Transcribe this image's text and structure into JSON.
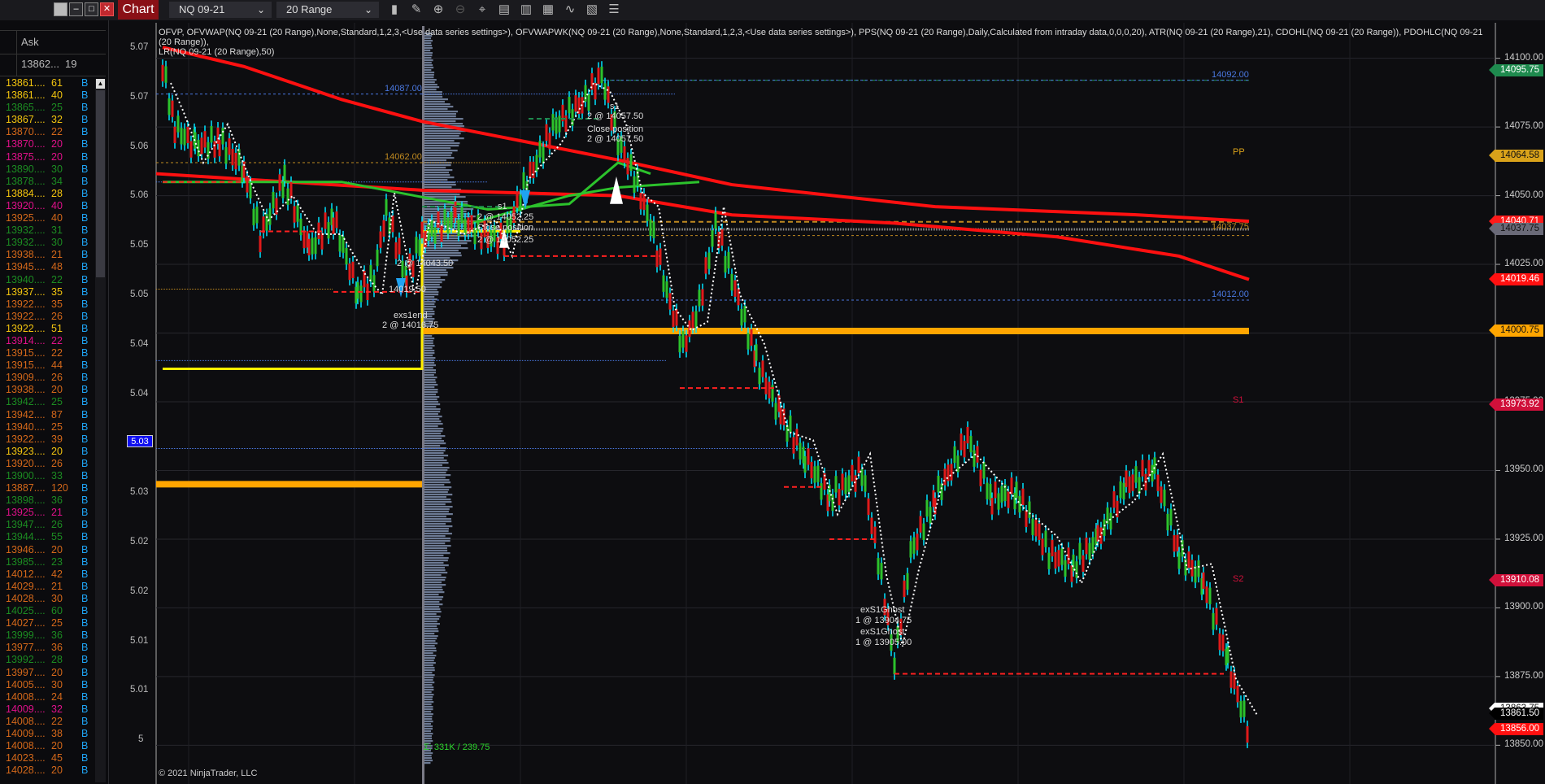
{
  "window": {
    "buttons": [
      "minimize-all",
      "minimize",
      "maximize",
      "close"
    ]
  },
  "toolbar": {
    "tab_label": "Chart",
    "instrument": "NQ 09-21",
    "bar_type": "20 Range",
    "icons": [
      "bar-style-icon",
      "drawing-tool-icon",
      "zoom-in-icon",
      "zoom-out-icon",
      "crosshair-icon",
      "data-box-icon",
      "chart-trader-icon",
      "strategies-icon",
      "indicators-icon",
      "properties-icon",
      "templates-icon"
    ]
  },
  "left_panel": {
    "header": "Ask",
    "ask_price": "13862...",
    "ask_size": "19",
    "rows": [
      {
        "p": "13861....",
        "q": "61",
        "c": "#f2c40f"
      },
      {
        "p": "13861....",
        "q": "40",
        "c": "#f2c40f"
      },
      {
        "p": "13865....",
        "q": "25",
        "c": "#1c8c22"
      },
      {
        "p": "13867....",
        "q": "32",
        "c": "#f2c40f"
      },
      {
        "p": "13870....",
        "q": "22",
        "c": "#d4681a"
      },
      {
        "p": "13870....",
        "q": "20",
        "c": "#e0108a"
      },
      {
        "p": "13875....",
        "q": "20",
        "c": "#e0108a"
      },
      {
        "p": "13890....",
        "q": "30",
        "c": "#1c8c22"
      },
      {
        "p": "13878....",
        "q": "34",
        "c": "#1c8c22"
      },
      {
        "p": "13884....",
        "q": "28",
        "c": "#f2c40f"
      },
      {
        "p": "13920....",
        "q": "40",
        "c": "#e0108a"
      },
      {
        "p": "13925....",
        "q": "40",
        "c": "#d4681a"
      },
      {
        "p": "13932....",
        "q": "31",
        "c": "#1c8c22"
      },
      {
        "p": "13932....",
        "q": "30",
        "c": "#1c8c22"
      },
      {
        "p": "13938....",
        "q": "21",
        "c": "#d4681a"
      },
      {
        "p": "13945....",
        "q": "48",
        "c": "#d4681a"
      },
      {
        "p": "13940....",
        "q": "22",
        "c": "#1c8c22"
      },
      {
        "p": "13937....",
        "q": "35",
        "c": "#f2c40f"
      },
      {
        "p": "13922....",
        "q": "35",
        "c": "#d4681a"
      },
      {
        "p": "13922....",
        "q": "26",
        "c": "#d4681a"
      },
      {
        "p": "13922....",
        "q": "51",
        "c": "#f2c40f"
      },
      {
        "p": "13914....",
        "q": "22",
        "c": "#e0108a"
      },
      {
        "p": "13915....",
        "q": "22",
        "c": "#d4681a"
      },
      {
        "p": "13915....",
        "q": "44",
        "c": "#d4681a"
      },
      {
        "p": "13909....",
        "q": "26",
        "c": "#d4681a"
      },
      {
        "p": "13938....",
        "q": "20",
        "c": "#d4681a"
      },
      {
        "p": "13942....",
        "q": "25",
        "c": "#1c8c22"
      },
      {
        "p": "13942....",
        "q": "87",
        "c": "#d4681a"
      },
      {
        "p": "13940....",
        "q": "25",
        "c": "#d4681a"
      },
      {
        "p": "13922....",
        "q": "39",
        "c": "#d4681a"
      },
      {
        "p": "13923....",
        "q": "20",
        "c": "#f2c40f"
      },
      {
        "p": "13920....",
        "q": "26",
        "c": "#d4681a"
      },
      {
        "p": "13900....",
        "q": "33",
        "c": "#1c8c22"
      },
      {
        "p": "13887....",
        "q": "120",
        "c": "#d4681a"
      },
      {
        "p": "13898....",
        "q": "36",
        "c": "#1c8c22"
      },
      {
        "p": "13925....",
        "q": "21",
        "c": "#e0108a"
      },
      {
        "p": "13947....",
        "q": "26",
        "c": "#1c8c22"
      },
      {
        "p": "13944....",
        "q": "55",
        "c": "#1c8c22"
      },
      {
        "p": "13946....",
        "q": "20",
        "c": "#d4681a"
      },
      {
        "p": "13985....",
        "q": "23",
        "c": "#1c8c22"
      },
      {
        "p": "14012....",
        "q": "42",
        "c": "#d4681a"
      },
      {
        "p": "14029....",
        "q": "21",
        "c": "#d4681a"
      },
      {
        "p": "14028....",
        "q": "30",
        "c": "#d4681a"
      },
      {
        "p": "14025....",
        "q": "60",
        "c": "#1c8c22"
      },
      {
        "p": "14027....",
        "q": "25",
        "c": "#d4681a"
      },
      {
        "p": "13999....",
        "q": "36",
        "c": "#1c8c22"
      },
      {
        "p": "13977....",
        "q": "36",
        "c": "#d4681a"
      },
      {
        "p": "13992....",
        "q": "28",
        "c": "#1c8c22"
      },
      {
        "p": "13997....",
        "q": "20",
        "c": "#d4681a"
      },
      {
        "p": "14005....",
        "q": "30",
        "c": "#d4681a"
      },
      {
        "p": "14008....",
        "q": "24",
        "c": "#d4681a"
      },
      {
        "p": "14009....",
        "q": "32",
        "c": "#e0108a"
      },
      {
        "p": "14008....",
        "q": "22",
        "c": "#d4681a"
      },
      {
        "p": "14009....",
        "q": "38",
        "c": "#d4681a"
      },
      {
        "p": "14008....",
        "q": "20",
        "c": "#d4681a"
      },
      {
        "p": "14023....",
        "q": "45",
        "c": "#d4681a"
      },
      {
        "p": "14028....",
        "q": "20",
        "c": "#d4681a"
      }
    ],
    "side_label": "B"
  },
  "chart": {
    "indicator_line1": "OFVP, OFVWAP(NQ 09-21 (20 Range),None,Standard,1,2,3,<Use data series settings>), OFVWAPWK(NQ 09-21 (20 Range),None,Standard,1,2,3,<Use data series settings>), PPS(NQ 09-21 (20 Range),Daily,Calculated from intraday data,0,0,0,20), ATR(NQ 09-21 (20 Range),21), CDOHL(NQ 09-21 (20 Range)), PDOHLC(NQ 09-21 (20 Range)),",
    "indicator_line2": "LR(NQ 09-21 (20 Range),50)",
    "left_axis_ticks": [
      "5.07",
      "5.07",
      "5.06",
      "5.06",
      "5.05",
      "5.05",
      "5.04",
      "5.04",
      "5.03",
      "5.03",
      "5.02",
      "5.02",
      "5.01",
      "5.01",
      "5"
    ],
    "left_axis_cursor": "5.03",
    "right_axis_ticks": [
      "14100.00",
      "14075.00",
      "14050.00",
      "14025.00",
      "14000.00",
      "13975.00",
      "13950.00",
      "13925.00",
      "13900.00",
      "13875.00",
      "13850.00"
    ],
    "right_axis_range": [
      13843,
      14107
    ],
    "price_tags": [
      {
        "value": "14095.75",
        "bg": "#1e8a4e",
        "fg": "#fff",
        "price": 14095.75
      },
      {
        "value": "14064.58",
        "bg": "#d9a21a",
        "fg": "#111",
        "price": 14064.58
      },
      {
        "value": "14040.71",
        "bg": "#ff1a1a",
        "fg": "#fff",
        "price": 14040.7
      },
      {
        "value": "14037.75",
        "bg": "#6a6a78",
        "fg": "#111",
        "price": 14037.75
      },
      {
        "value": "14019.46",
        "bg": "#ff1010",
        "fg": "#fff",
        "price": 14019.46
      },
      {
        "value": "14000.75",
        "bg": "#ffa500",
        "fg": "#111",
        "price": 14000.75
      },
      {
        "value": "13973.92",
        "bg": "#d0103a",
        "fg": "#fff",
        "price": 13973.92
      },
      {
        "value": "13910.08",
        "bg": "#d0103a",
        "fg": "#fff",
        "price": 13910.08
      },
      {
        "value": "13863.75",
        "bg": "#ffffff",
        "fg": "#111",
        "price": 13863.2
      },
      {
        "value": "13861.50",
        "bg": "#000000",
        "fg": "#fff",
        "price": 13861.5
      },
      {
        "value": "13856.00",
        "bg": "#ff1010",
        "fg": "#fff",
        "price": 13856.0
      }
    ],
    "level_labels": [
      {
        "text": "14092.00",
        "color": "#4a78e0"
      },
      {
        "text": "14087.00",
        "color": "#4a78e0"
      },
      {
        "text": "14062.00",
        "color": "#c08a20"
      },
      {
        "text": "14012.00",
        "color": "#4a78e0"
      },
      {
        "text": "14037.75",
        "color": "#c08a20"
      }
    ],
    "pivot_labels": [
      {
        "text": "PP",
        "color": "#d9a21a"
      },
      {
        "text": "S1",
        "color": "#d0103a"
      },
      {
        "text": "S2",
        "color": "#d0103a"
      }
    ],
    "trade_annotations": [
      {
        "text": "s1"
      },
      {
        "text": "2 @ 14057.50"
      },
      {
        "text": "Close position"
      },
      {
        "text": "2 @ 14057.50"
      },
      {
        "text": "s1"
      },
      {
        "text": "2 @ 14052.25"
      },
      {
        "text": "Close position"
      },
      {
        "text": "2 @ 14052.25"
      },
      {
        "text": "2 @ 14043.50"
      },
      {
        "text": "14019.50"
      },
      {
        "text": "exs1end"
      },
      {
        "text": "2 @ 14016.75"
      },
      {
        "text": "exS1Ghost"
      },
      {
        "text": "1 @ 13904.75"
      },
      {
        "text": "exS1Ghost"
      },
      {
        "text": "1 @ 13905.00"
      }
    ],
    "volume_profile_summary": "Σ: 331K / 239.75",
    "copyright": "© 2021 NinjaTrader, LLC"
  }
}
